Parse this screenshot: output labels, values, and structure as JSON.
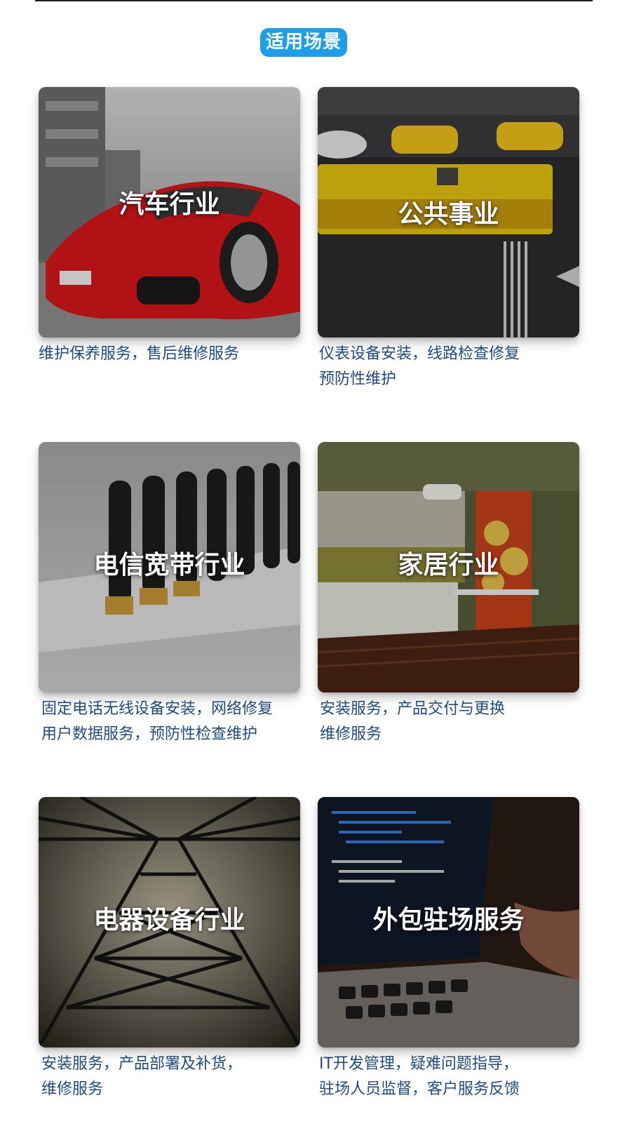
{
  "section": {
    "title": "适用场景"
  },
  "scenes": [
    {
      "title": "汽车行业",
      "photo_icon": "red-sports-car-photo",
      "desc": [
        "维护保养服务，售后维修服务"
      ]
    },
    {
      "title": "公共事业",
      "photo_icon": "city-street-bus-photo",
      "desc": [
        "仪表设备安装，线路检查修复",
        "预防性维护"
      ]
    },
    {
      "title": "电信宽带行业",
      "photo_icon": "antenna-router-photo",
      "desc": [
        "固定电话无线设备安装，网络修复",
        "用户数据服务，预防性检查维护"
      ]
    },
    {
      "title": "家居行业",
      "photo_icon": "kitchen-interior-photo",
      "desc": [
        "安装服务，产品交付与更换",
        "维修服务"
      ]
    },
    {
      "title": "电器设备行业",
      "photo_icon": "power-tower-photo",
      "desc": [
        "安装服务，产品部署及补货，",
        "维修服务"
      ]
    },
    {
      "title": "外包驻场服务",
      "photo_icon": "laptop-code-photo",
      "desc": [
        "IT开发管理，疑难问题指导，",
        "驻场人员监督，客户服务反馈"
      ]
    }
  ]
}
